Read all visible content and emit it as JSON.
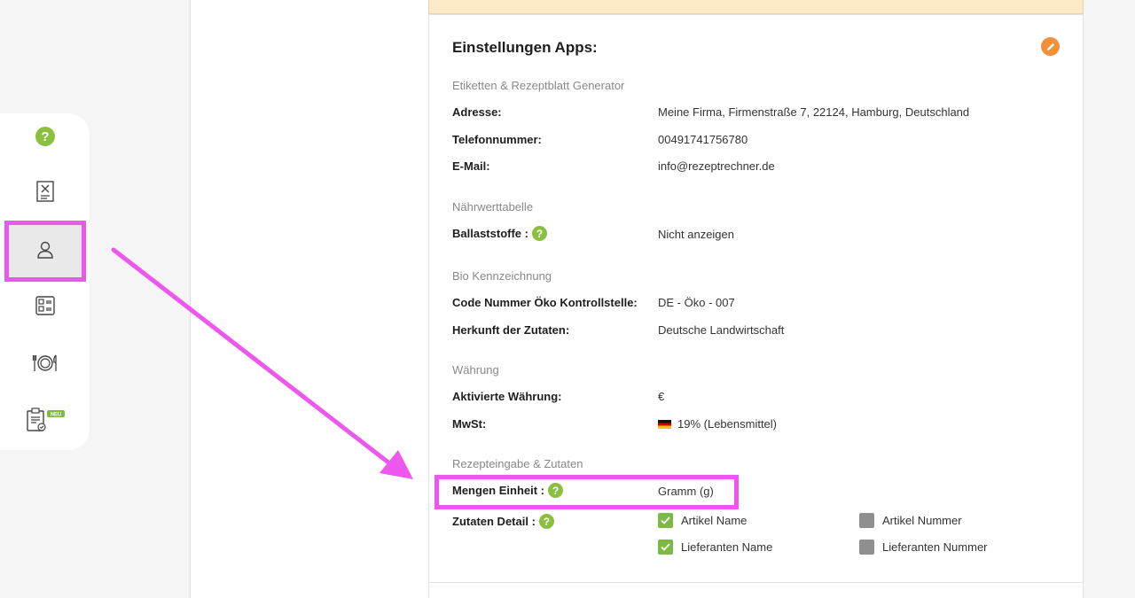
{
  "sidebar": {
    "items": [
      {
        "icon": "help-icon"
      },
      {
        "icon": "recipe-book-icon"
      },
      {
        "icon": "user-icon",
        "active": true
      },
      {
        "icon": "checklist-icon"
      },
      {
        "icon": "plate-cutlery-icon"
      },
      {
        "icon": "clipboard-check-icon",
        "badge": "NEU"
      }
    ]
  },
  "settings": {
    "title": "Einstellungen Apps:",
    "sections": {
      "labels_generator": "Etiketten & Rezeptblatt Generator",
      "nutrition": "Nährwerttabelle",
      "bio": "Bio Kennzeichnung",
      "currency": "Währung",
      "recipe": "Rezepteingabe & Zutaten"
    },
    "fields": {
      "address_label": "Adresse:",
      "address_value": "Meine Firma, Firmenstraße 7, 22124, Hamburg, Deutschland",
      "phone_label": "Telefonnummer:",
      "phone_value": "00491741756780",
      "email_label": "E-Mail:",
      "email_value": "info@rezeptrechner.de",
      "fiber_label": "Ballaststoffe :",
      "fiber_value": "Nicht anzeigen",
      "eco_code_label": "Code Nummer Öko Kontrollstelle:",
      "eco_code_value": "DE - Öko - 007",
      "origin_label": "Herkunft der Zutaten:",
      "origin_value": "Deutsche Landwirtschaft",
      "currency_label": "Aktivierte Währung:",
      "currency_value": "€",
      "vat_label": "MwSt:",
      "vat_value": "19% (Lebensmittel)",
      "unit_label": "Mengen Einheit :",
      "unit_value": "Gramm (g)",
      "ingredient_detail_label": "Zutaten Detail :"
    },
    "ingredient_options": [
      {
        "label": "Artikel Name",
        "checked": true
      },
      {
        "label": "Artikel Nummer",
        "checked": false
      },
      {
        "label": "Lieferanten Name",
        "checked": true
      },
      {
        "label": "Lieferanten Nummer",
        "checked": false
      }
    ]
  },
  "colors": {
    "accent_green": "#8bbf3f",
    "highlight": "#ee57ee",
    "edit_orange": "#f0913a"
  }
}
